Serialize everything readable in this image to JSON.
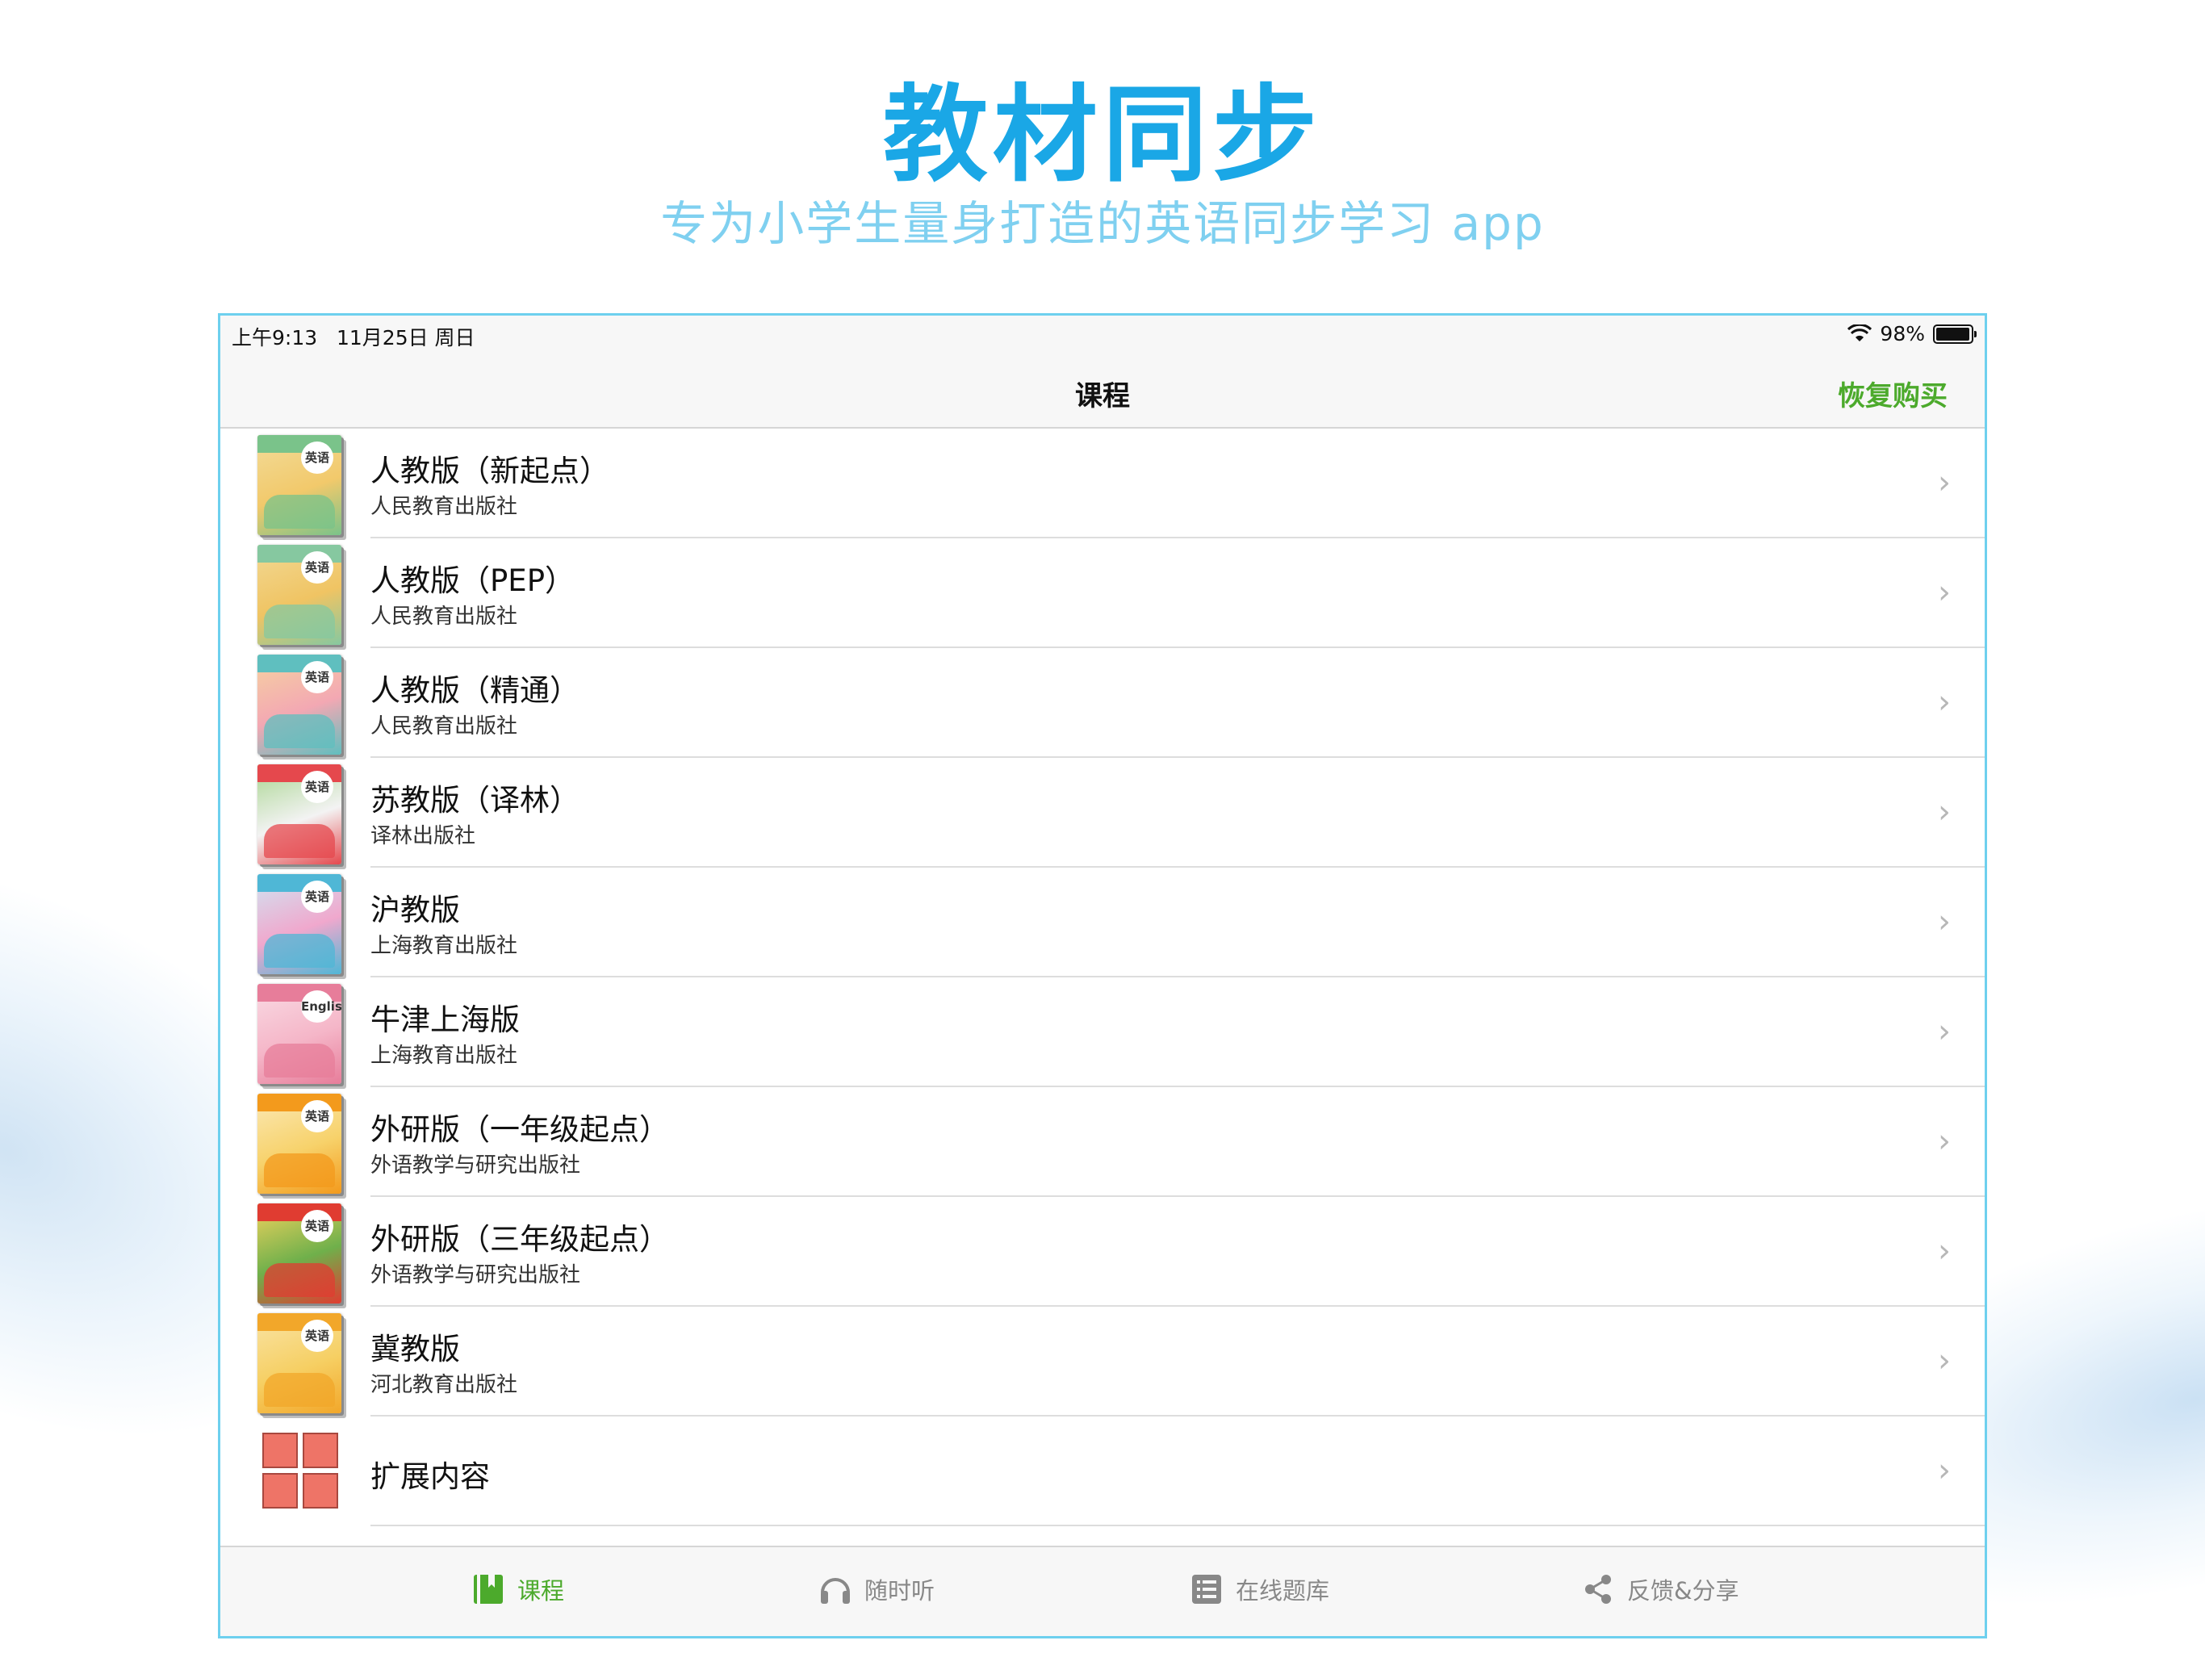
{
  "hero": {
    "title": "教材同步",
    "subtitle": "专为小学生量身打造的英语同步学习 app"
  },
  "statusbar": {
    "time": "上午9:13",
    "date": "11月25日 周日",
    "battery": "98%",
    "battery_level": 0.98
  },
  "navbar": {
    "title": "课程",
    "restore_label": "恢复购买"
  },
  "courses": [
    {
      "title": "人教版（新起点）",
      "publisher": "人民教育出版社",
      "badge": "英语",
      "cover_colors": [
        "#7ac38a",
        "#f2c96b",
        "#f3dc9a"
      ]
    },
    {
      "title": "人教版（PEP）",
      "publisher": "人民教育出版社",
      "badge": "英语",
      "cover_colors": [
        "#86c8a0",
        "#f0c463",
        "#f2d995"
      ]
    },
    {
      "title": "人教版（精通）",
      "publisher": "人民教育出版社",
      "badge": "英语",
      "cover_colors": [
        "#5fbfbf",
        "#f3a8b3",
        "#f6d3a0"
      ]
    },
    {
      "title": "苏教版（译林）",
      "publisher": "译林出版社",
      "badge": "英语",
      "cover_colors": [
        "#e5484d",
        "#f3f3f3",
        "#a8d58f"
      ]
    },
    {
      "title": "沪教版",
      "publisher": "上海教育出版社",
      "badge": "英语",
      "cover_colors": [
        "#4fb7d6",
        "#f0a8cd",
        "#cfe6f3"
      ]
    },
    {
      "title": "牛津上海版",
      "publisher": "上海教育出版社",
      "badge": "English",
      "cover_colors": [
        "#e77d9a",
        "#f5b6c8",
        "#f9dbe4"
      ]
    },
    {
      "title": "外研版（一年级起点）",
      "publisher": "外语教学与研究出版社",
      "badge": "英语",
      "cover_colors": [
        "#f39a1c",
        "#f7d26b",
        "#fbe9b7"
      ]
    },
    {
      "title": "外研版（三年级起点）",
      "publisher": "外语教学与研究出版社",
      "badge": "英语",
      "cover_colors": [
        "#e03c31",
        "#6fb04b",
        "#f2d35e"
      ]
    },
    {
      "title": "冀教版",
      "publisher": "河北教育出版社",
      "badge": "英语",
      "cover_colors": [
        "#f2a72a",
        "#f6cf63",
        "#f9e4a6"
      ]
    }
  ],
  "extension": {
    "title": "扩展内容",
    "icon": "grid-icon",
    "color": "#ee7467"
  },
  "tabs": [
    {
      "label": "课程",
      "icon": "book-icon",
      "active": true
    },
    {
      "label": "随时听",
      "icon": "headphones-icon",
      "active": false
    },
    {
      "label": "在线题库",
      "icon": "list-icon",
      "active": false
    },
    {
      "label": "反馈&分享",
      "icon": "share-icon",
      "active": false
    }
  ],
  "colors": {
    "accent_green": "#4caa2c",
    "hero_blue": "#1aa7e6",
    "subtitle_blue": "#7fd0f0"
  }
}
